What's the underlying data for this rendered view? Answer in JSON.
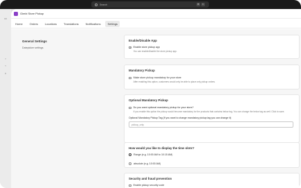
{
  "browser": {
    "search_placeholder": "Search",
    "kbd1": "⌘",
    "kbd2": "K"
  },
  "app": {
    "title": "Gimbi Store Pickup"
  },
  "tabs": [
    {
      "label": "Home"
    },
    {
      "label": "Orders"
    },
    {
      "label": "Locations"
    },
    {
      "label": "Translations"
    },
    {
      "label": "Notifications"
    },
    {
      "label": "Settings",
      "active": true
    }
  ],
  "general": {
    "title": "General Settings",
    "description": "Datepicker settings"
  },
  "enable_card": {
    "title": "Enable/Disable App",
    "checkbox_label": "Enable store pickup app",
    "help": "You can enable/disable the store pickup app."
  },
  "mandatory_card": {
    "title": "Mandatory Pickup",
    "checkbox_label": "Make store pickup mandatory for your store",
    "help": "After enabling this option, customers would only be able to place only pickup orders."
  },
  "optional_card": {
    "title": "Optional Mandatory Pickup",
    "checkbox_label": "Do you want optional mandatory pickup for your store?",
    "help": "If you enable this option the pickup would become mandatory for the products that contains below tag. You can change the below tag as well. Click to save.",
    "field_label": "Optional Mandatory Pickup Tag (If you want to change mandatory pickup tag you can change it)",
    "field_value": "pickup_only"
  },
  "timeslot_card": {
    "title": "How would you like to display the time slots?",
    "options": [
      {
        "label": "Range (e.g. 10:00 AM to 10:15 AM)",
        "selected": true
      },
      {
        "label": "absolute (e.g. 10:00 AM)",
        "selected": false
      }
    ]
  },
  "security_card": {
    "title": "Security and fraud prevention",
    "checkbox_label": "Enable pickup security code"
  },
  "colors": {
    "accent": "#8a3fc7",
    "background": "#f6f6f6",
    "topbar": "#1a1a1a"
  }
}
